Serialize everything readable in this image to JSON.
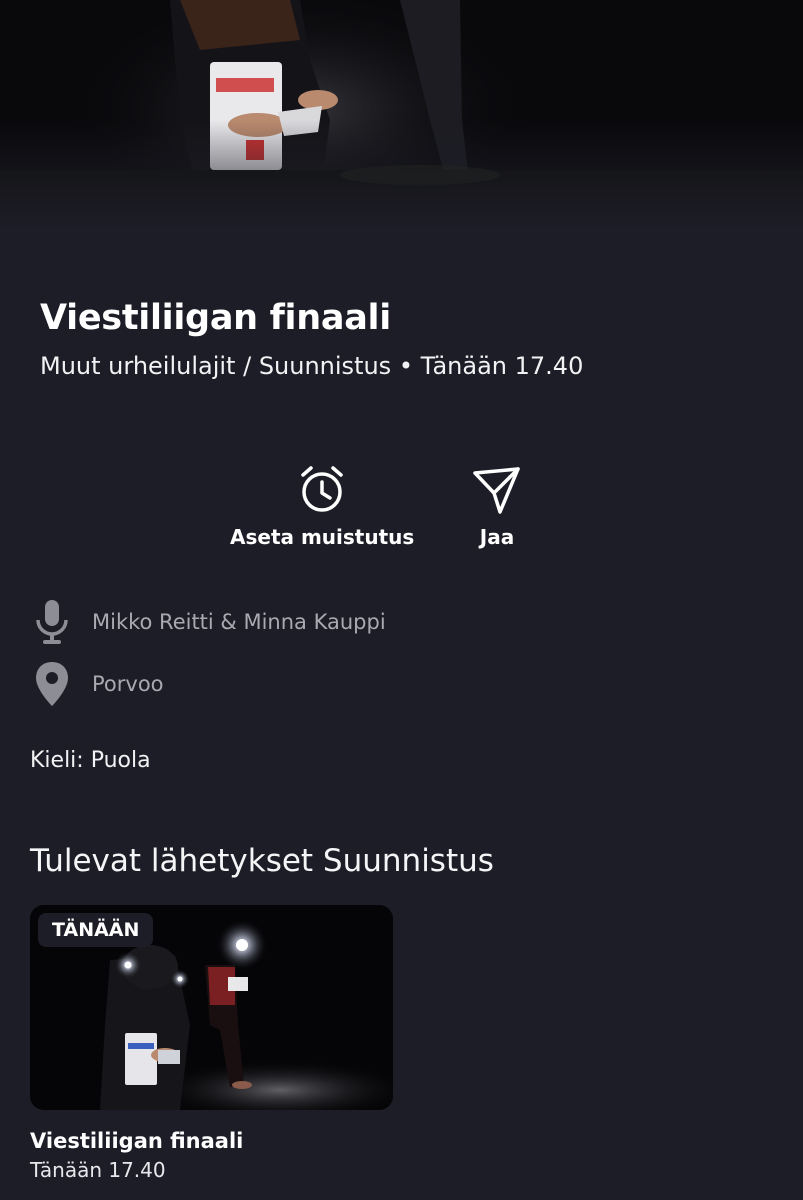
{
  "program": {
    "title": "Viestiliigan finaali",
    "subtitle": "Muut urheilulajit / Suunnistus • Tänään 17.40"
  },
  "actions": {
    "reminder_label": "Aseta muistutus",
    "reminder_icon": "alarm-clock-icon",
    "share_label": "Jaa",
    "share_icon": "send-icon"
  },
  "info": {
    "commentators": "Mikko Reitti & Minna Kauppi",
    "commentators_icon": "microphone-icon",
    "location": "Porvoo",
    "location_icon": "location-pin-icon",
    "language": "Kieli: Puola"
  },
  "upcoming": {
    "section_title": "Tulevat lähetykset Suunnistus",
    "items": [
      {
        "badge": "TÄNÄÄN",
        "title": "Viestiliigan finaali",
        "time": "Tänään 17.40"
      }
    ]
  },
  "colors": {
    "background": "#1d1d27",
    "text": "#ffffff",
    "muted_text": "#a9a9b1",
    "icon_muted": "#8d8d95"
  }
}
